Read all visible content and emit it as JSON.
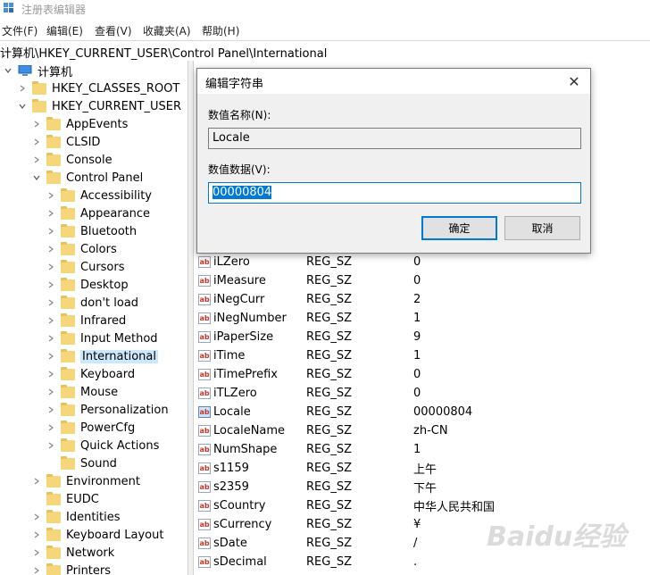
{
  "window": {
    "title": "注册表编辑器"
  },
  "menu": [
    "文件(F)",
    "编辑(E)",
    "查看(V)",
    "收藏夹(A)",
    "帮助(H)"
  ],
  "address": "计算机\\HKEY_CURRENT_USER\\Control Panel\\International",
  "tree": {
    "root": "计算机",
    "hkcr": "HKEY_CLASSES_ROOT",
    "hkcu": "HKEY_CURRENT_USER",
    "hkcu_children": [
      "AppEvents",
      "CLSID",
      "Console",
      "Control Panel"
    ],
    "control_panel_children": [
      "Accessibility",
      "Appearance",
      "Bluetooth",
      "Colors",
      "Cursors",
      "Desktop",
      "don't load",
      "Infrared",
      "Input Method",
      "International",
      "Keyboard",
      "Mouse",
      "Personalization",
      "PowerCfg",
      "Quick Actions",
      "Sound"
    ],
    "more_hkcu_children": [
      "Environment",
      "EUDC",
      "Identities",
      "Keyboard Layout",
      "Network",
      "Printers"
    ],
    "selected": "International"
  },
  "values": [
    {
      "name": "iLZero",
      "type": "REG_SZ",
      "data": "0"
    },
    {
      "name": "iMeasure",
      "type": "REG_SZ",
      "data": "0"
    },
    {
      "name": "iNegCurr",
      "type": "REG_SZ",
      "data": "2"
    },
    {
      "name": "iNegNumber",
      "type": "REG_SZ",
      "data": "1"
    },
    {
      "name": "iPaperSize",
      "type": "REG_SZ",
      "data": "9"
    },
    {
      "name": "iTime",
      "type": "REG_SZ",
      "data": "1"
    },
    {
      "name": "iTimePrefix",
      "type": "REG_SZ",
      "data": "0"
    },
    {
      "name": "iTLZero",
      "type": "REG_SZ",
      "data": "0"
    },
    {
      "name": "Locale",
      "type": "REG_SZ",
      "data": "00000804"
    },
    {
      "name": "LocaleName",
      "type": "REG_SZ",
      "data": "zh-CN"
    },
    {
      "name": "NumShape",
      "type": "REG_SZ",
      "data": "1"
    },
    {
      "name": "s1159",
      "type": "REG_SZ",
      "data": "上午"
    },
    {
      "name": "s2359",
      "type": "REG_SZ",
      "data": "下午"
    },
    {
      "name": "sCountry",
      "type": "REG_SZ",
      "data": "中华人民共和国"
    },
    {
      "name": "sCurrency",
      "type": "REG_SZ",
      "data": "¥"
    },
    {
      "name": "sDate",
      "type": "REG_SZ",
      "data": "/"
    },
    {
      "name": "sDecimal",
      "type": "REG_SZ",
      "data": "."
    }
  ],
  "value_icon_text": "ab",
  "dialog": {
    "title": "编辑字符串",
    "name_label": "数值名称(N):",
    "name_value": "Locale",
    "data_label": "数值数据(V):",
    "data_value": "00000804",
    "ok": "确定",
    "cancel": "取消"
  },
  "watermark": "Baidu经验"
}
